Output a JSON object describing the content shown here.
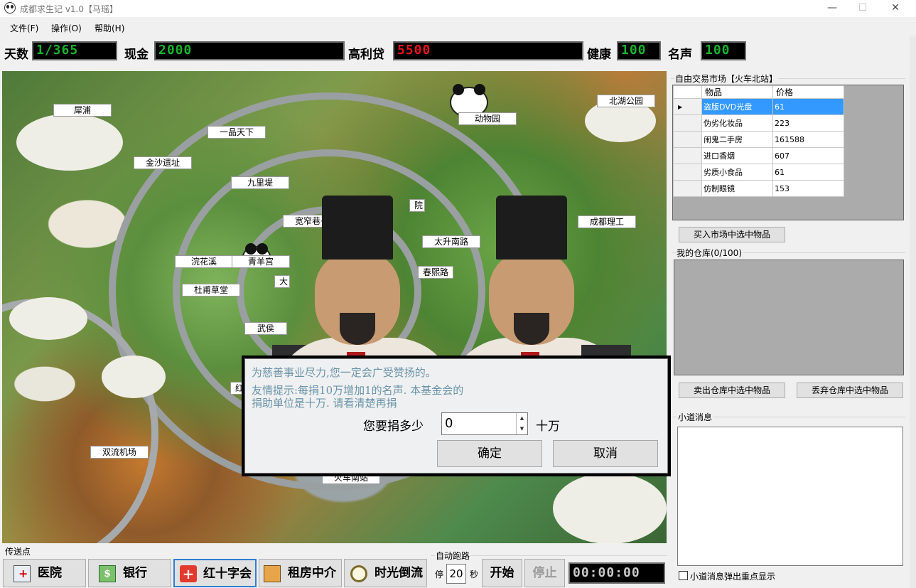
{
  "window": {
    "title": "成都求生记  v1.0【马瑶】",
    "min": "—",
    "max": "☐",
    "close": "✕"
  },
  "menu": [
    "文件(F)",
    "操作(O)",
    "帮助(H)"
  ],
  "stats": {
    "days_label": "天数",
    "days_value": "1/365",
    "cash_label": "现金",
    "cash_value": "2000",
    "debt_label": "高利贷",
    "debt_value": "5500",
    "health_label": "健康",
    "health_value": "100",
    "fame_label": "名声",
    "fame_value": "100"
  },
  "map": {
    "places": [
      "犀浦",
      "一品天下",
      "金沙遗址",
      "九里堤",
      "宽窄巷子",
      "浣花溪",
      "青羊宫",
      "杜甫草堂",
      "武侯",
      "红",
      "双流机场",
      "火车南站",
      "动物园",
      "北湖公园",
      "成都理工",
      "太升南路",
      "春熙路",
      "大",
      "院"
    ]
  },
  "dialog": {
    "line1": "为慈善事业尽力,您一定会广受赞扬的。",
    "line2": "友情提示:每捐10万增加1的名声. 本基金会的",
    "line3": "捐助单位是十万.  请看清楚再捐",
    "question": "您要捐多少",
    "amount": "0",
    "unit": "十万",
    "ok": "确定",
    "cancel": "取消",
    "spin_up": "▲",
    "spin_down": "▼"
  },
  "market": {
    "title": "自由交易市场【火车北站】",
    "col_item": "物品",
    "col_price": "价格",
    "row_marker": "▶",
    "rows": [
      {
        "item": "盗版DVD光盘",
        "price": "61"
      },
      {
        "item": "伪劣化妆品",
        "price": "223"
      },
      {
        "item": "闹鬼二手房",
        "price": "161588"
      },
      {
        "item": "进口香烟",
        "price": "607"
      },
      {
        "item": "劣质小食品",
        "price": "61"
      },
      {
        "item": "仿制眼镜",
        "price": "153"
      }
    ],
    "buy_button": "买入市场中选中物品"
  },
  "warehouse": {
    "title": "我的仓库(0/100)",
    "sell_button": "卖出仓库中选中物品",
    "discard_button": "丢弃仓库中选中物品"
  },
  "news": {
    "title": "小道消息",
    "checkbox_label": "小道消息弹出重点显示"
  },
  "teleport": {
    "title": "传送点",
    "buttons": [
      "医院",
      "银行",
      "红十字会",
      "租房中介",
      "时光倒流"
    ],
    "bank_glyph": "$",
    "red_cross_glyph": "+"
  },
  "autorun": {
    "title": "自动跑路",
    "stop_prefix": "停",
    "seconds": "20",
    "seconds_suffix": "秒",
    "start": "开始",
    "stop": "停止",
    "timer": "00:00:00"
  },
  "colors": {
    "lcd_green": "#17b32c",
    "lcd_red": "#e4151b",
    "selection": "#3399ff",
    "dialog_text": "#6a93a8"
  }
}
